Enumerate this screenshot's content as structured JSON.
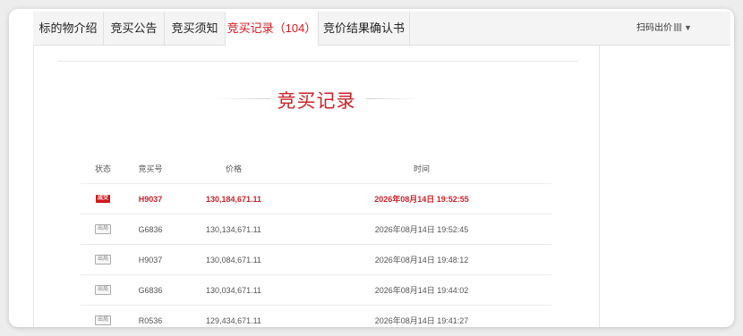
{
  "tabs": [
    {
      "label": "标的物介绍",
      "active": false
    },
    {
      "label": "竞买公告",
      "active": false
    },
    {
      "label": "竞买须知",
      "active": false
    },
    {
      "label": "竞买记录（104）",
      "active": true
    },
    {
      "label": "竞价结果确认书",
      "active": false
    }
  ],
  "scan_bid": {
    "label": "扫码出价",
    "icons": [
      "qr-code-icon",
      "caret-down-icon"
    ]
  },
  "section_title": "竞买记录",
  "table": {
    "headers": [
      "状态",
      "竞买号",
      "价格",
      "时间"
    ],
    "rows": [
      {
        "status": "成交",
        "status_type": "deal",
        "bid_no": "H9037",
        "price": "130,184,671.11",
        "time": "2026年08月14日 19:52:55"
      },
      {
        "status": "出局",
        "status_type": "out",
        "bid_no": "G6836",
        "price": "130,134,671.11",
        "time": "2026年08月14日 19:52:45"
      },
      {
        "status": "出局",
        "status_type": "out",
        "bid_no": "H9037",
        "price": "130,084,671.11",
        "time": "2026年08月14日 19:48:12"
      },
      {
        "status": "出局",
        "status_type": "out",
        "bid_no": "G6836",
        "price": "130,034,671.11",
        "time": "2026年08月14日 19:44:02"
      },
      {
        "status": "出局",
        "status_type": "out",
        "bid_no": "R0536",
        "price": "129,434,671.11",
        "time": "2026年08月14日 19:41:27"
      }
    ]
  },
  "colors": {
    "accent": "#d4181f",
    "title": "#c9242c",
    "background": "#ededed"
  }
}
